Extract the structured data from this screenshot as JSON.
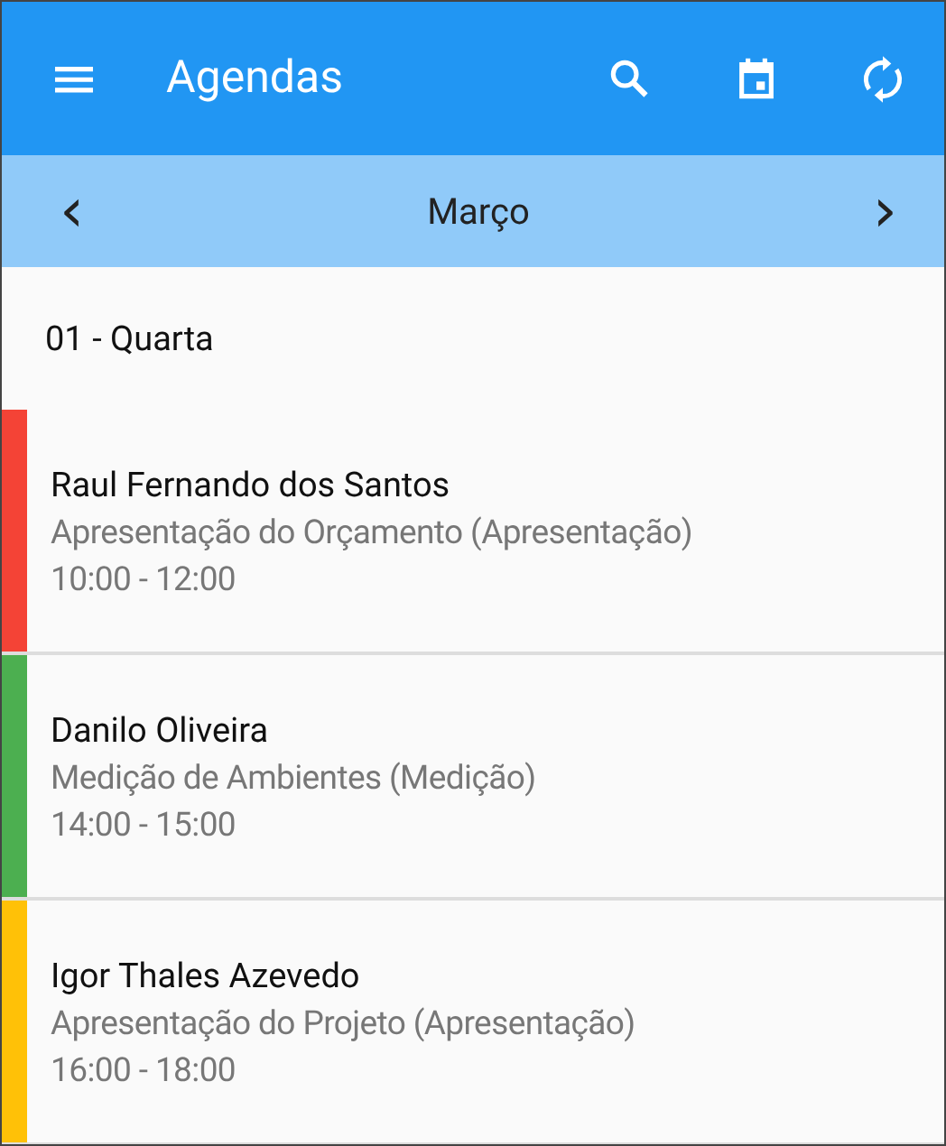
{
  "app_bar": {
    "title": "Agendas"
  },
  "month_bar": {
    "previous": "‹",
    "month": "Março",
    "next": "›"
  },
  "day_header": "01 - Quarta",
  "appointments": [
    {
      "client": "Raul Fernando dos Santos",
      "activity": "Apresentação do Orçamento (Apresentação)",
      "time": "10:00 - 12:00",
      "color": "#f44336"
    },
    {
      "client": "Danilo Oliveira",
      "activity": "Medição de Ambientes (Medição)",
      "time": "14:00 - 15:00",
      "color": "#4caf50"
    },
    {
      "client": "Igor Thales Azevedo",
      "activity": "Apresentação do Projeto (Apresentação)",
      "time": "16:00 - 18:00",
      "color": "#ffc107"
    }
  ]
}
